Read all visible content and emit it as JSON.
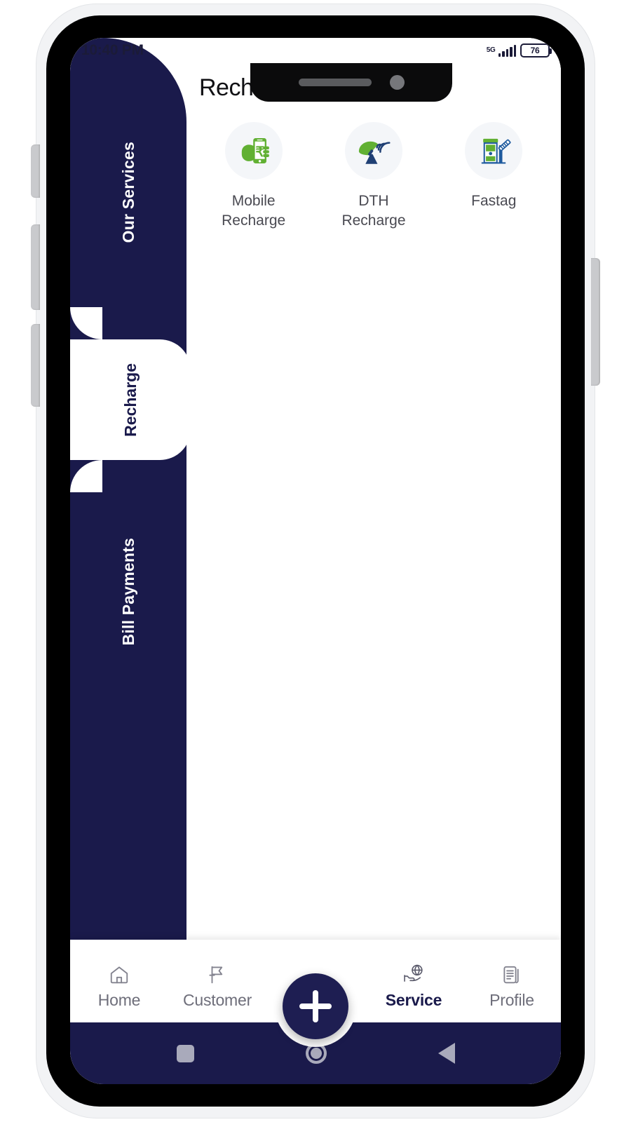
{
  "status_bar": {
    "time": "10:40 PM",
    "network_label": "5G",
    "battery_percent": "76"
  },
  "sidebar": {
    "tabs": [
      {
        "label": "Our Services",
        "active": false
      },
      {
        "label": "Recharge",
        "active": true
      },
      {
        "label": "Bill Payments",
        "active": false
      }
    ]
  },
  "content": {
    "title": "Recharge",
    "services": [
      {
        "label": "Mobile\nRecharge",
        "icon": "mobile-recharge-icon"
      },
      {
        "label": "DTH\nRecharge",
        "icon": "dth-recharge-icon"
      },
      {
        "label": "Fastag",
        "icon": "fastag-icon"
      }
    ]
  },
  "bottom_nav": {
    "fab_icon": "plus-icon",
    "items": [
      {
        "label": "Home",
        "icon": "home-icon",
        "active": false
      },
      {
        "label": "Customer",
        "icon": "flag-icon",
        "active": false
      },
      {
        "label": "Service",
        "icon": "globe-hand-icon",
        "active": true
      },
      {
        "label": "Profile",
        "icon": "documents-icon",
        "active": false
      }
    ]
  },
  "android_nav": {
    "recents": "square-icon",
    "home": "circle-icon",
    "back": "triangle-left-icon"
  },
  "colors": {
    "navy": "#1a1a4b",
    "green": "#61b033",
    "icon_blue": "#1f5b9e",
    "circle_bg": "#f4f6f9",
    "muted_text": "#6e6e7a"
  }
}
